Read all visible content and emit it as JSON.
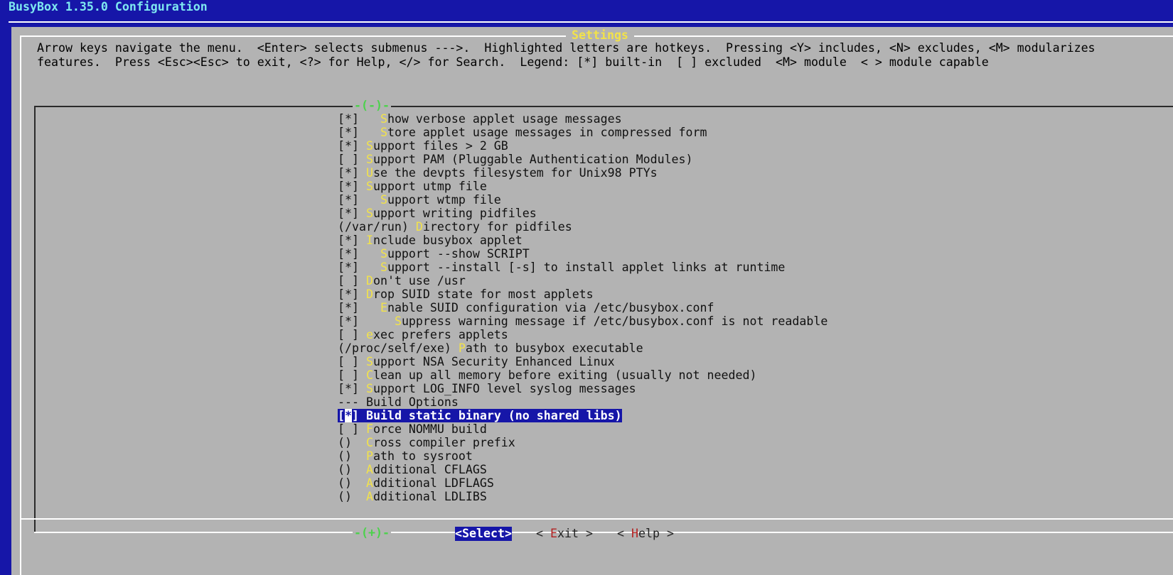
{
  "window": {
    "title": "BusyBox 1.35.0 Configuration"
  },
  "dialog": {
    "title": "Settings",
    "help_line_1": "Arrow keys navigate the menu.  <Enter> selects submenus --->.  Highlighted letters are hotkeys.  Pressing <Y> includes, <N> excludes, <M> modularizes",
    "help_line_2": "features.  Press <Esc><Esc> to exit, <?> for Help, </> for Search.  Legend: [*] built-in  [ ] excluded  <M> module  < > module capable",
    "scroll_up": "-(-)-",
    "scroll_down": "-(+)-"
  },
  "menu": {
    "items": [
      {
        "prefix": "[*]   ",
        "hot": "S",
        "rest": "how verbose applet usage messages"
      },
      {
        "prefix": "[*]   ",
        "hot": "S",
        "rest": "tore applet usage messages in compressed form"
      },
      {
        "prefix": "[*] ",
        "hot": "S",
        "rest": "upport files > 2 GB"
      },
      {
        "prefix": "[ ] ",
        "hot": "S",
        "rest": "upport PAM (Pluggable Authentication Modules)"
      },
      {
        "prefix": "[*] ",
        "hot": "U",
        "rest": "se the devpts filesystem for Unix98 PTYs"
      },
      {
        "prefix": "[*] ",
        "hot": "S",
        "rest": "upport utmp file"
      },
      {
        "prefix": "[*]   ",
        "hot": "S",
        "rest": "upport wtmp file"
      },
      {
        "prefix": "[*] ",
        "hot": "S",
        "rest": "upport writing pidfiles"
      },
      {
        "prefix": "(/var/run) ",
        "hot": "D",
        "rest": "irectory for pidfiles"
      },
      {
        "prefix": "[*] ",
        "hot": "I",
        "rest": "nclude busybox applet"
      },
      {
        "prefix": "[*]   ",
        "hot": "S",
        "rest": "upport --show SCRIPT"
      },
      {
        "prefix": "[*]   ",
        "hot": "S",
        "rest": "upport --install [-s] to install applet links at runtime"
      },
      {
        "prefix": "[ ] ",
        "hot": "D",
        "rest": "on't use /usr"
      },
      {
        "prefix": "[*] ",
        "hot": "D",
        "rest": "rop SUID state for most applets"
      },
      {
        "prefix": "[*]   ",
        "hot": "E",
        "rest": "nable SUID configuration via /etc/busybox.conf"
      },
      {
        "prefix": "[*]     ",
        "hot": "S",
        "rest": "uppress warning message if /etc/busybox.conf is not readable"
      },
      {
        "prefix": "[ ] ",
        "hot": "e",
        "rest": "xec prefers applets"
      },
      {
        "prefix": "(/proc/self/exe) ",
        "hot": "P",
        "rest": "ath to busybox executable"
      },
      {
        "prefix": "[ ] ",
        "hot": "S",
        "rest": "upport NSA Security Enhanced Linux"
      },
      {
        "prefix": "[ ] ",
        "hot": "C",
        "rest": "lean up all memory before exiting (usually not needed)"
      },
      {
        "prefix": "[*] ",
        "hot": "S",
        "rest": "upport LOG_INFO level syslog messages"
      },
      {
        "prefix": "--- Build Options",
        "hot": "",
        "rest": ""
      },
      {
        "prefix": "[*] ",
        "hot": "B",
        "rest": "uild static binary (no shared libs)"
      },
      {
        "prefix": "[ ] ",
        "hot": "F",
        "rest": "orce NOMMU build"
      },
      {
        "prefix": "()  ",
        "hot": "C",
        "rest": "ross compiler prefix"
      },
      {
        "prefix": "()  ",
        "hot": "P",
        "rest": "ath to sysroot"
      },
      {
        "prefix": "()  ",
        "hot": "A",
        "rest": "dditional CFLAGS"
      },
      {
        "prefix": "()  ",
        "hot": "A",
        "rest": "dditional LDFLAGS"
      },
      {
        "prefix": "()  ",
        "hot": "A",
        "rest": "dditional LDLIBS"
      }
    ],
    "selected_index": 22
  },
  "buttons": {
    "select": {
      "open": "<",
      "hot": "S",
      "rest": "elect",
      "close": ">"
    },
    "exit": {
      "open": "< ",
      "hot": "E",
      "rest": "xit",
      "close": " >"
    },
    "help": {
      "open": "< ",
      "hot": "H",
      "rest": "elp",
      "close": " >"
    }
  },
  "colors": {
    "background": "#1616a8",
    "dialog": "#b3b3b3",
    "hotkey": "#f2e24a",
    "title": "#7ee8f0",
    "scroll_arrow": "#4cd24c"
  }
}
